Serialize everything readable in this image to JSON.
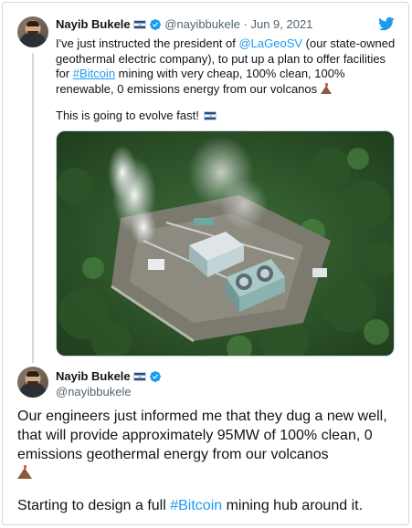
{
  "parent_tweet": {
    "name": "Nayib Bukele",
    "handle": "@nayibbukele",
    "separator": "·",
    "date": "Jun 9, 2021",
    "text_part1": "I've just instructed the president of ",
    "mention": "@LaGeoSV",
    "text_part2": " (our state-owned geothermal electric company), to put up a plan to offer facilities for ",
    "hashtag": "#Bitcoin",
    "text_part3": " mining with very cheap, 100% clean, 100% renewable, 0 emissions energy from our volcanos",
    "line2": "This is going to evolve fast!",
    "image_icon": "geothermal-plant-photo"
  },
  "reply_tweet": {
    "name": "Nayib Bukele",
    "handle": "@nayibbukele",
    "text": "Our engineers just informed me that they dug a new well, that will provide approximately 95MW of 100% clean, 0 emissions geothermal energy from our volcanos",
    "line2_part1": "Starting to design a full ",
    "hashtag": "#Bitcoin",
    "line2_part2": " mining hub around it."
  },
  "colors": {
    "link": "#1d9bf0",
    "text": "#0f1419",
    "secondary": "#536471",
    "border": "#cfd9de"
  },
  "icons": [
    "twitter-bird-icon",
    "verified-badge-icon",
    "el-salvador-flag-icon",
    "volcano-emoji-icon"
  ]
}
